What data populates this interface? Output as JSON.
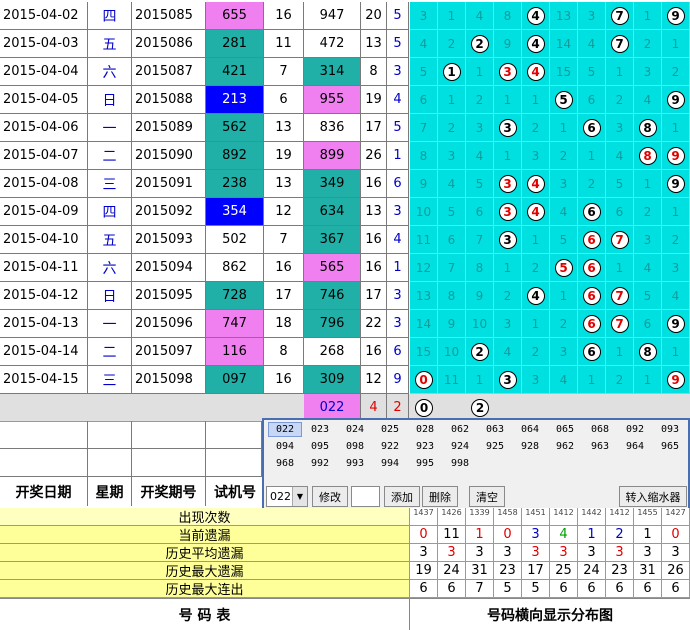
{
  "rows": [
    {
      "date": "2015-04-02",
      "weekday": "四",
      "issue": "2015085",
      "test": "655",
      "test_bg": "#f080f0",
      "a": "16",
      "win": "947",
      "win_bg": "#ffffff",
      "sum": "20",
      "span": "5",
      "dist": [
        "3",
        "1",
        "4",
        "8",
        "4",
        "13",
        "3",
        "7",
        "1",
        "9"
      ],
      "hits": [
        4,
        7,
        9
      ],
      "red": []
    },
    {
      "date": "2015-04-03",
      "weekday": "五",
      "issue": "2015086",
      "test": "281",
      "test_bg": "#20b0a8",
      "a": "11",
      "win": "472",
      "win_bg": "#ffffff",
      "sum": "13",
      "span": "5",
      "dist": [
        "4",
        "2",
        "2",
        "9",
        "4",
        "14",
        "4",
        "7",
        "2",
        "1"
      ],
      "hits": [
        2,
        4,
        7
      ],
      "red": []
    },
    {
      "date": "2015-04-04",
      "weekday": "六",
      "issue": "2015087",
      "test": "421",
      "test_bg": "#20b0a8",
      "a": "7",
      "win": "314",
      "win_bg": "#20b0a8",
      "sum": "8",
      "span": "3",
      "dist": [
        "5",
        "1",
        "1",
        "3",
        "4",
        "15",
        "5",
        "1",
        "3",
        "2"
      ],
      "hits": [
        1,
        3,
        4
      ],
      "red": [
        3,
        4
      ]
    },
    {
      "date": "2015-04-05",
      "weekday": "日",
      "issue": "2015088",
      "test": "213",
      "test_bg": "#0000ff",
      "a": "6",
      "win": "955",
      "win_bg": "#f080f0",
      "sum": "19",
      "span": "4",
      "dist": [
        "6",
        "1",
        "2",
        "1",
        "1",
        "5",
        "6",
        "2",
        "4",
        "9"
      ],
      "hits": [
        5,
        9
      ],
      "red": []
    },
    {
      "date": "2015-04-06",
      "weekday": "一",
      "issue": "2015089",
      "test": "562",
      "test_bg": "#20b0a8",
      "a": "13",
      "win": "836",
      "win_bg": "#ffffff",
      "sum": "17",
      "span": "5",
      "dist": [
        "7",
        "2",
        "3",
        "3",
        "2",
        "1",
        "6",
        "3",
        "8",
        "1"
      ],
      "hits": [
        3,
        6,
        8
      ],
      "red": []
    },
    {
      "date": "2015-04-07",
      "weekday": "二",
      "issue": "2015090",
      "test": "892",
      "test_bg": "#20b0a8",
      "a": "19",
      "win": "899",
      "win_bg": "#f080f0",
      "sum": "26",
      "span": "1",
      "dist": [
        "8",
        "3",
        "4",
        "1",
        "3",
        "2",
        "1",
        "4",
        "8",
        "9"
      ],
      "hits": [
        8,
        9
      ],
      "red": [
        8,
        9
      ]
    },
    {
      "date": "2015-04-08",
      "weekday": "三",
      "issue": "2015091",
      "test": "238",
      "test_bg": "#20b0a8",
      "a": "13",
      "win": "349",
      "win_bg": "#20b0a8",
      "sum": "16",
      "span": "6",
      "dist": [
        "9",
        "4",
        "5",
        "3",
        "4",
        "3",
        "2",
        "5",
        "1",
        "9"
      ],
      "hits": [
        3,
        4,
        9
      ],
      "red": [
        3,
        4
      ]
    },
    {
      "date": "2015-04-09",
      "weekday": "四",
      "issue": "2015092",
      "test": "354",
      "test_bg": "#0000ff",
      "a": "12",
      "win": "634",
      "win_bg": "#20b0a8",
      "sum": "13",
      "span": "3",
      "dist": [
        "10",
        "5",
        "6",
        "3",
        "4",
        "4",
        "6",
        "6",
        "2",
        "1"
      ],
      "hits": [
        3,
        4,
        6
      ],
      "red": [
        3,
        4
      ]
    },
    {
      "date": "2015-04-10",
      "weekday": "五",
      "issue": "2015093",
      "test": "502",
      "test_bg": "#ffffff",
      "a": "7",
      "win": "367",
      "win_bg": "#20b0a8",
      "sum": "16",
      "span": "4",
      "dist": [
        "11",
        "6",
        "7",
        "3",
        "1",
        "5",
        "6",
        "7",
        "3",
        "2"
      ],
      "hits": [
        3,
        6,
        7
      ],
      "red": [
        6,
        7
      ]
    },
    {
      "date": "2015-04-11",
      "weekday": "六",
      "issue": "2015094",
      "test": "862",
      "test_bg": "#ffffff",
      "a": "16",
      "win": "565",
      "win_bg": "#f080f0",
      "sum": "16",
      "span": "1",
      "dist": [
        "12",
        "7",
        "8",
        "1",
        "2",
        "5",
        "6",
        "1",
        "4",
        "3"
      ],
      "hits": [
        5,
        6
      ],
      "red": [
        5,
        6
      ]
    },
    {
      "date": "2015-04-12",
      "weekday": "日",
      "issue": "2015095",
      "test": "728",
      "test_bg": "#20b0a8",
      "a": "17",
      "win": "746",
      "win_bg": "#20b0a8",
      "sum": "17",
      "span": "3",
      "dist": [
        "13",
        "8",
        "9",
        "2",
        "4",
        "1",
        "6",
        "7",
        "5",
        "4"
      ],
      "hits": [
        4,
        6,
        7
      ],
      "red": [
        6,
        7
      ]
    },
    {
      "date": "2015-04-13",
      "weekday": "一",
      "issue": "2015096",
      "test": "747",
      "test_bg": "#f080f0",
      "a": "18",
      "win": "796",
      "win_bg": "#20b0a8",
      "sum": "22",
      "span": "3",
      "dist": [
        "14",
        "9",
        "10",
        "3",
        "1",
        "2",
        "6",
        "7",
        "6",
        "9"
      ],
      "hits": [
        6,
        7,
        9
      ],
      "red": [
        6,
        7
      ]
    },
    {
      "date": "2015-04-14",
      "weekday": "二",
      "issue": "2015097",
      "test": "116",
      "test_bg": "#f080f0",
      "a": "8",
      "win": "268",
      "win_bg": "#ffffff",
      "sum": "16",
      "span": "6",
      "dist": [
        "15",
        "10",
        "2",
        "4",
        "2",
        "3",
        "6",
        "1",
        "8",
        "1"
      ],
      "hits": [
        2,
        6,
        8
      ],
      "red": []
    },
    {
      "date": "2015-04-15",
      "weekday": "三",
      "issue": "2015098",
      "test": "097",
      "test_bg": "#20b0a8",
      "a": "16",
      "win": "309",
      "win_bg": "#20b0a8",
      "sum": "12",
      "span": "9",
      "dist": [
        "0",
        "11",
        "1",
        "3",
        "3",
        "4",
        "1",
        "2",
        "1",
        "9"
      ],
      "hits": [
        0,
        3,
        9
      ],
      "red": [
        0,
        9
      ]
    }
  ],
  "extra_row": {
    "win": "022",
    "sum": "4",
    "span": "2",
    "hits": [
      "0",
      "2"
    ]
  },
  "headers": {
    "date": "开奖日期",
    "weekday": "星期",
    "issue": "开奖期号",
    "test": "试机号"
  },
  "panel": {
    "codes": [
      [
        "022",
        "023",
        "024",
        "025",
        "028",
        "062",
        "063",
        "064",
        "065",
        "068",
        "092",
        "093"
      ],
      [
        "094",
        "095",
        "098",
        "922",
        "923",
        "924",
        "925",
        "928",
        "962",
        "963",
        "964",
        "965"
      ],
      [
        "968",
        "992",
        "993",
        "994",
        "995",
        "998"
      ]
    ],
    "select_value": "022",
    "buttons": {
      "modify": "修改",
      "add": "添加",
      "delete": "删除",
      "clear": "清空",
      "shrink": "转入缩水器"
    }
  },
  "stats": {
    "digits_small": [
      "1437",
      "1426",
      "1339",
      "1458",
      "1451",
      "1412",
      "1442",
      "1412",
      "1455",
      "1427"
    ],
    "labels": [
      "出现次数",
      "当前遗漏",
      "历史平均遗漏",
      "历史最大遗漏",
      "历史最大连出"
    ],
    "current_miss": [
      "0",
      "11",
      "1",
      "0",
      "3",
      "4",
      "1",
      "2",
      "1",
      "0"
    ],
    "avg_miss": [
      "3",
      "3",
      "3",
      "3",
      "3",
      "3",
      "3",
      "3",
      "3",
      "3"
    ],
    "max_miss": [
      "19",
      "24",
      "31",
      "23",
      "17",
      "25",
      "24",
      "23",
      "31",
      "26"
    ],
    "max_consec": [
      "6",
      "6",
      "7",
      "5",
      "5",
      "6",
      "6",
      "6",
      "6",
      "6"
    ]
  },
  "footer": {
    "left": "号   码   表",
    "right": "号码横向显示分布图"
  }
}
